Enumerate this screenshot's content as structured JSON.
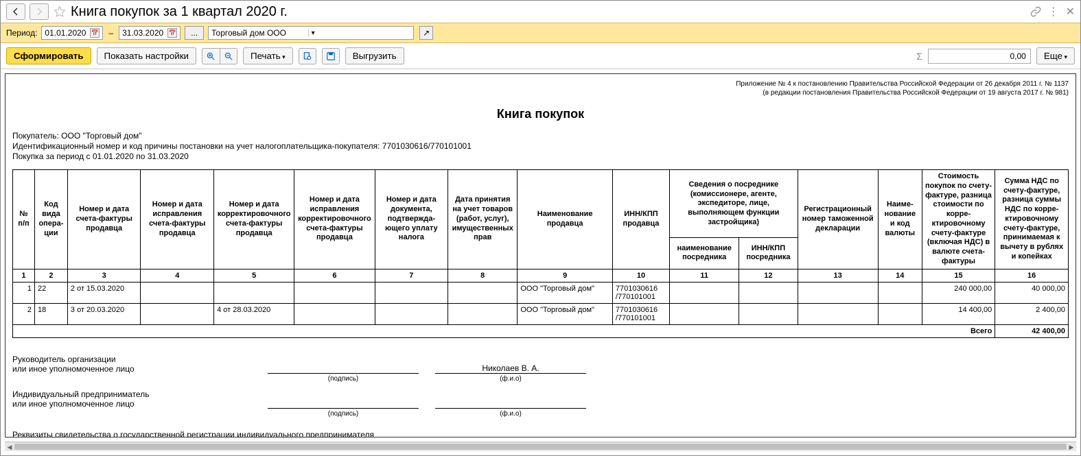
{
  "title": "Книга покупок за 1 квартал 2020 г.",
  "period": {
    "label": "Период:",
    "from": "01.01.2020",
    "to": "31.03.2020",
    "org": "Торговый дом ООО"
  },
  "toolbar": {
    "generate": "Сформировать",
    "show_settings": "Показать настройки",
    "print": "Печать",
    "export": "Выгрузить",
    "more": "Еще",
    "total_value": "0,00"
  },
  "report": {
    "annex1": "Приложение № 4 к постановлению Правительства Российской Федерации от 26 декабря 2011 г. № 1137",
    "annex2": "(в редакции постановления Правительства Российской Федерации от 19 августа 2017 г. № 981)",
    "title": "Книга покупок",
    "buyer": "Покупатель:  ООО \"Торговый дом\"",
    "inn_kpp": "Идентификационный номер и код причины постановки на учет налогоплательщика-покупателя:  7701030616/770101001",
    "period_line": "Покупка за период с 01.01.2020 по 31.03.2020"
  },
  "headers": {
    "c1": "№ п/п",
    "c2": "Код вида опера­ции",
    "c3": "Номер и дата счета-фактуры продавца",
    "c4": "Номер и дата исправления счета-фактуры продавца",
    "c5": "Номер и дата корректировоч­ного счета-фактуры продавца",
    "c6": "Номер и дата исправления корректировоч­ного счета-фактуры продавца",
    "c7": "Номер и дата документа, подтвержда­ющего уплату налога",
    "c8": "Дата принятия на учет товаров (работ, услуг), имущес­твенных прав",
    "c9": "Наименование продавца",
    "c10": "ИНН/КПП продавца",
    "c11g": "Сведения о посреднике (комиссионере, агенте, экспедиторе, лице, выполняющем функции застройщика)",
    "c11": "наименование посредника",
    "c12": "ИНН/КПП посредника",
    "c13": "Регистрационный номер таможенной декларации",
    "c14": "Наиме­нование и код валюты",
    "c15": "Стоимость покупок по счету-фактуре, разница стои­мости по корре­ктировочному счету-фактуре (включая НДС) в валюте счета-фактуры",
    "c16": "Сумма НДС по счету-фактуре, разница суммы НДС по корре­ктировочному счету-фактуре, принимаемая к вычету в рублях и копейках"
  },
  "rows": [
    {
      "n": "1",
      "code": "22",
      "sf": "2 от 15.03.2020",
      "corr": "",
      "name": "ООО \"Торговый дом\"",
      "inn": "7701030616 /770101001",
      "cost": "240 000,00",
      "vat": "40 000,00"
    },
    {
      "n": "2",
      "code": "18",
      "sf": "3 от 20.03.2020",
      "corr": "4 от 28.03.2020",
      "name": "ООО \"Торговый дом\"",
      "inn": "7701030616 /770101001",
      "cost": "14 400,00",
      "vat": "2 400,00"
    }
  ],
  "totals": {
    "label": "Всего",
    "vat": "42 400,00"
  },
  "sig": {
    "l1": "Руководитель организации",
    "l2": "или иное уполномоченное лицо",
    "l3": "Индивидуальный предприниматель",
    "l4": "или иное уполномоченное лицо",
    "name": "Николаев В. А.",
    "podpis": "(подпись)",
    "fio": "(ф.и.о)",
    "rekv": "Реквизиты свидетельства о государственной регистрации индивидуального предпринимателя"
  }
}
